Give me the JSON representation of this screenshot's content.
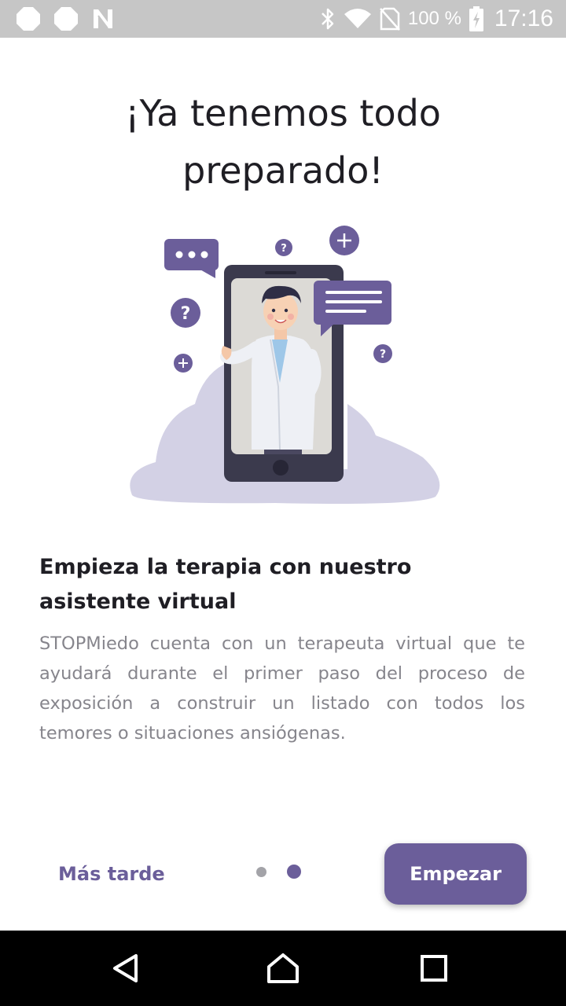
{
  "status_bar": {
    "left_icons": [
      "notification-dot-icon",
      "notification-dot-icon",
      "n-app-icon"
    ],
    "right_icons": [
      "bluetooth-icon",
      "wifi-icon",
      "no-sim-icon",
      "battery-charging-icon"
    ],
    "battery": "100 %",
    "time": "17:16"
  },
  "header": {
    "title_line1": "¡Ya tenemos todo",
    "title_line2": "preparado!"
  },
  "illustration": {
    "name": "virtual-doctor-phone-illustration"
  },
  "content": {
    "title": "Empieza la terapia con nuestro asistente virtual",
    "body": "STOPMiedo cuenta con un terapeuta virtual que te ayudará durante el primer paso del proceso de exposición a construir un listado con todos los temores o situaciones ansiógenas."
  },
  "footer": {
    "later_label": "Más tarde",
    "start_label": "Empezar",
    "page_count": 2,
    "current_page": 2
  },
  "nav_bar": {
    "buttons": [
      "back-icon",
      "home-icon",
      "recents-icon"
    ]
  },
  "colors": {
    "accent": "#6b5e9a",
    "blob": "#d3d1e5",
    "phone": "#3b3a4d",
    "status_bar": "#c6c6c6",
    "text_dark": "#1f1e24",
    "text_body": "#86858c"
  }
}
